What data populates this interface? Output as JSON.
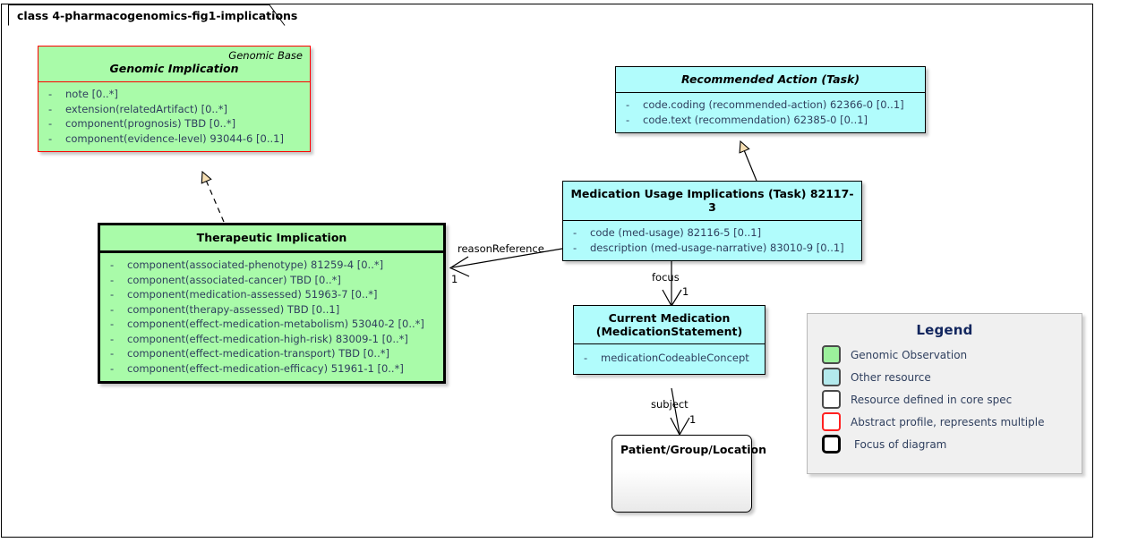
{
  "diagram": {
    "tab_label": "class 4-pharmacogenomics-fig1-implications"
  },
  "classes": {
    "genomic_implication": {
      "stereotype": "Genomic Base",
      "title": "Genomic Implication",
      "attributes": [
        "note [0..*]",
        "extension(relatedArtifact) [0..*]",
        "component(prognosis) TBD [0..*]",
        "component(evidence-level) 93044-6 [0..1]"
      ]
    },
    "therapeutic_implication": {
      "title": "Therapeutic Implication",
      "attributes": [
        "component(associated-phenotype) 81259-4 [0..*]",
        "component(associated-cancer) TBD [0..*]",
        "component(medication-assessed) 51963-7 [0..*]",
        "component(therapy-assessed) TBD [0..1]",
        "component(effect-medication-metabolism) 53040-2 [0..*]",
        "component(effect-medication-high-risk) 83009-1 [0..*]",
        "component(effect-medication-transport) TBD [0..*]",
        "component(effect-medication-efficacy) 51961-1 [0..*]"
      ]
    },
    "recommended_action": {
      "title": "Recommended Action (Task)",
      "attributes": [
        "code.coding (recommended-action) 62366-0 [0..1]",
        "code.text (recommendation) 62385-0 [0..1]"
      ]
    },
    "medication_usage_implications": {
      "title": "Medication Usage Implications (Task) 82117-3",
      "attributes": [
        "code (med-usage) 82116-5 [0..1]",
        "description (med-usage-narrative) 83010-9 [0..1]"
      ]
    },
    "current_medication": {
      "title_line1": "Current Medication",
      "title_line2": "(MedicationStatement)",
      "attributes": [
        "medicationCodeableConcept"
      ]
    },
    "patient_group_location": {
      "title": "Patient/Group/Location"
    }
  },
  "edges": {
    "reason_reference": {
      "label": "reasonReference",
      "multiplicity": "1"
    },
    "focus": {
      "label": "focus",
      "multiplicity": "1"
    },
    "subject": {
      "label": "subject",
      "multiplicity": "1"
    }
  },
  "legend": {
    "title": "Legend",
    "items": [
      {
        "label": "Genomic Observation",
        "swatch": "green"
      },
      {
        "label": "Other resource",
        "swatch": "cyan"
      },
      {
        "label": "Resource defined in core spec",
        "swatch": "white"
      },
      {
        "label": "Abstract profile, represents multiple",
        "swatch": "red-outline"
      },
      {
        "label": "Focus of diagram",
        "swatch": "thick-black"
      }
    ]
  },
  "colors": {
    "genomic_observation": "#a9fba9",
    "other_resource": "#b1fcfc",
    "abstract_border": "#ff0000",
    "focus_border": "#000000",
    "legend_title": "#12265e",
    "attribute_text": "#2f3f5e",
    "arrowhead_fill": "#f5deb3"
  }
}
